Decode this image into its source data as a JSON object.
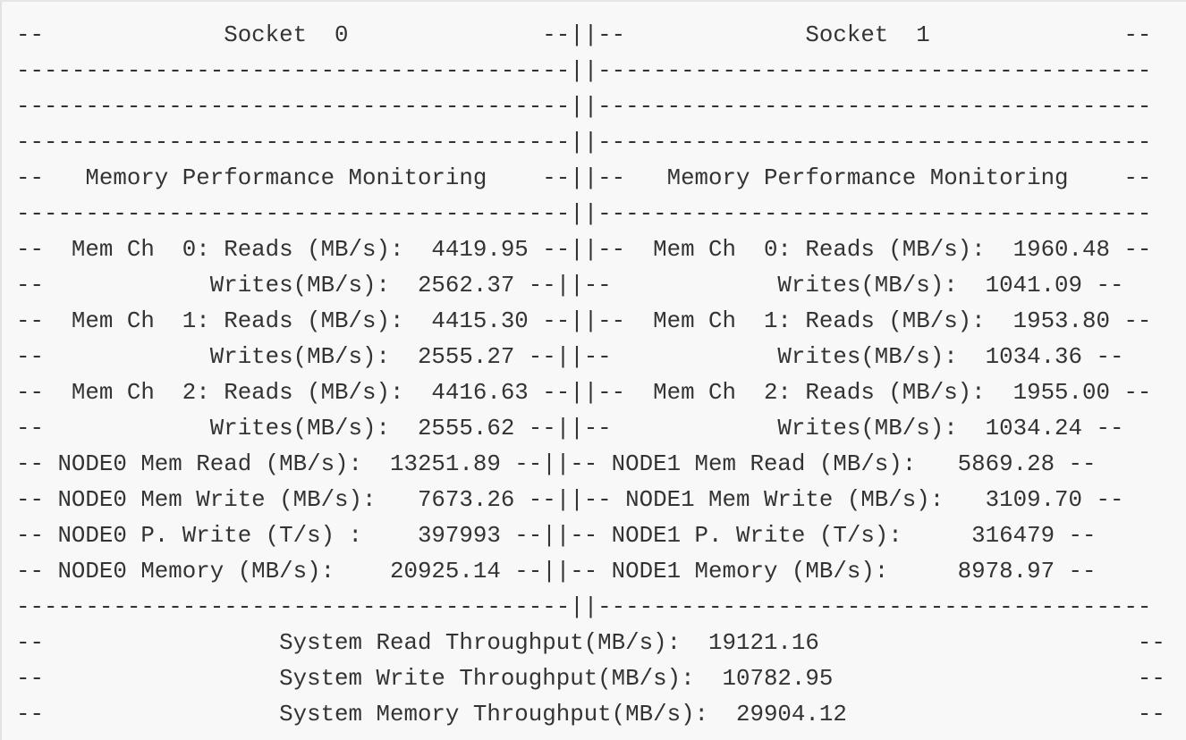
{
  "terminal": {
    "lines": [
      "--             Socket  0              --||--             Socket  1              --",
      "----------------------------------------||----------------------------------------",
      "----------------------------------------||----------------------------------------",
      "----------------------------------------||----------------------------------------",
      "--   Memory Performance Monitoring    --||--   Memory Performance Monitoring    --",
      "----------------------------------------||----------------------------------------",
      "--  Mem Ch  0: Reads (MB/s):  4419.95 --||--  Mem Ch  0: Reads (MB/s):  1960.48 --",
      "--            Writes(MB/s):  2562.37 --||--            Writes(MB/s):  1041.09 --",
      "--  Mem Ch  1: Reads (MB/s):  4415.30 --||--  Mem Ch  1: Reads (MB/s):  1953.80 --",
      "--            Writes(MB/s):  2555.27 --||--            Writes(MB/s):  1034.36 --",
      "--  Mem Ch  2: Reads (MB/s):  4416.63 --||--  Mem Ch  2: Reads (MB/s):  1955.00 --",
      "--            Writes(MB/s):  2555.62 --||--            Writes(MB/s):  1034.24 --",
      "-- NODE0 Mem Read (MB/s):  13251.89 --||-- NODE1 Mem Read (MB/s):   5869.28 --",
      "-- NODE0 Mem Write (MB/s):   7673.26 --||-- NODE1 Mem Write (MB/s):   3109.70 --",
      "-- NODE0 P. Write (T/s) :    397993 --||-- NODE1 P. Write (T/s):     316479 --",
      "-- NODE0 Memory (MB/s):    20925.14 --||-- NODE1 Memory (MB/s):     8978.97 --",
      "----------------------------------------||----------------------------------------",
      "--                 System Read Throughput(MB/s):  19121.16                       --",
      "--                 System Write Throughput(MB/s):  10782.95                      --",
      "--                 System Memory Throughput(MB/s):  29904.12                     --"
    ]
  }
}
